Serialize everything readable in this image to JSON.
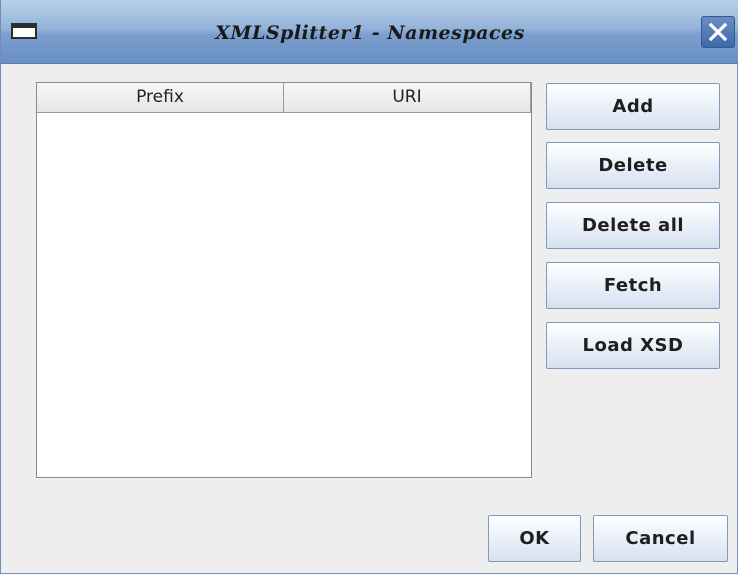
{
  "window": {
    "title": "XMLSplitter1 - Namespaces"
  },
  "table": {
    "columns": [
      "Prefix",
      "URI"
    ],
    "rows": []
  },
  "buttons": {
    "add": "Add",
    "delete": "Delete",
    "delete_all": "Delete all",
    "fetch": "Fetch",
    "load_xsd": "Load XSD",
    "ok": "OK",
    "cancel": "Cancel"
  },
  "icons": {
    "window_menu": "window-icon",
    "close": "close-icon"
  },
  "colors": {
    "titlebar": "#94b3da",
    "background": "#eeeeee",
    "button_border": "#7f9abf"
  }
}
